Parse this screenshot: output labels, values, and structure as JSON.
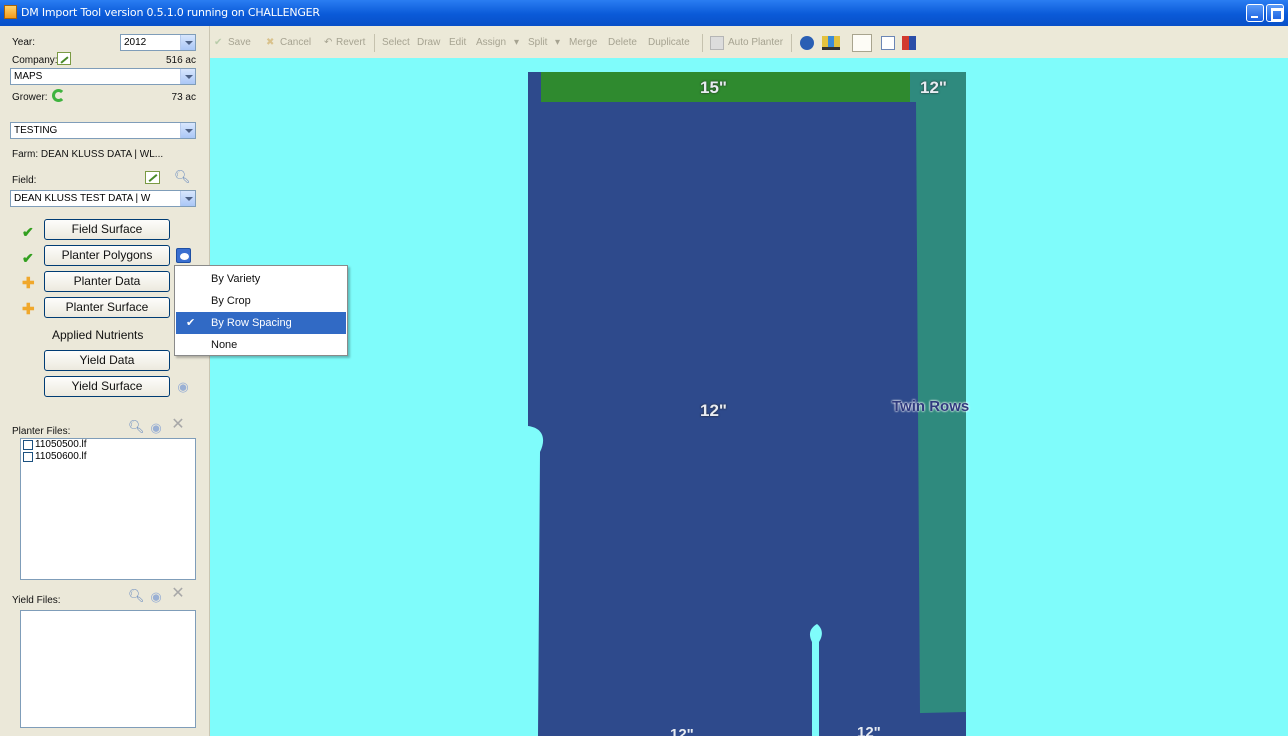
{
  "window": {
    "title": "DM Import Tool version 0.5.1.0 running on CHALLENGER"
  },
  "left_panel": {
    "year_label": "Year:",
    "year_value": "2012",
    "company_label": "Company:",
    "company_acres": "516 ac",
    "company_value": "MAPS",
    "grower_label": "Grower:",
    "grower_acres": "73 ac",
    "grower_value": "TESTING",
    "farm_text": "Farm: DEAN KLUSS DATA | WL...",
    "field_label": "Field:",
    "field_value": "DEAN KLUSS TEST DATA | W",
    "buttons": {
      "field_surface": "Field Surface",
      "planter_polygons": "Planter Polygons",
      "planter_data": "Planter Data",
      "planter_surface": "Planter Surface",
      "applied_nutrients": "Applied Nutrients",
      "yield_data": "Yield Data",
      "yield_surface": "Yield Surface"
    },
    "planter_files_label": "Planter Files:",
    "planter_files": [
      "11050500.lf",
      "11050600.lf"
    ],
    "yield_files_label": "Yield Files:"
  },
  "toolbar": {
    "save": "Save",
    "cancel": "Cancel",
    "revert": "Revert",
    "select": "Select",
    "draw": "Draw",
    "edit": "Edit",
    "assign": "Assign",
    "split": "Split",
    "merge": "Merge",
    "delete": "Delete",
    "duplicate": "Duplicate",
    "auto_planter": "Auto Planter"
  },
  "menu": {
    "items": [
      "By Variety",
      "By Crop",
      "By Row Spacing",
      "None"
    ],
    "selected": "By Row Spacing",
    "check_glyph": "✔"
  },
  "map": {
    "labels": {
      "top_left": "15\"",
      "top_right": "12\"",
      "center": "12\"",
      "right": "Twin Rows",
      "bottom_left": "12\"",
      "bottom_right": "12\""
    },
    "colors": {
      "background": "#7ffcfb",
      "main_field": "#2e4a8c",
      "top_strip": "#2f8a2f",
      "right_strip": "#2f8a7e",
      "label_fill": "#e8ecf2",
      "twin_rows_label": "#2f3a7e"
    }
  }
}
